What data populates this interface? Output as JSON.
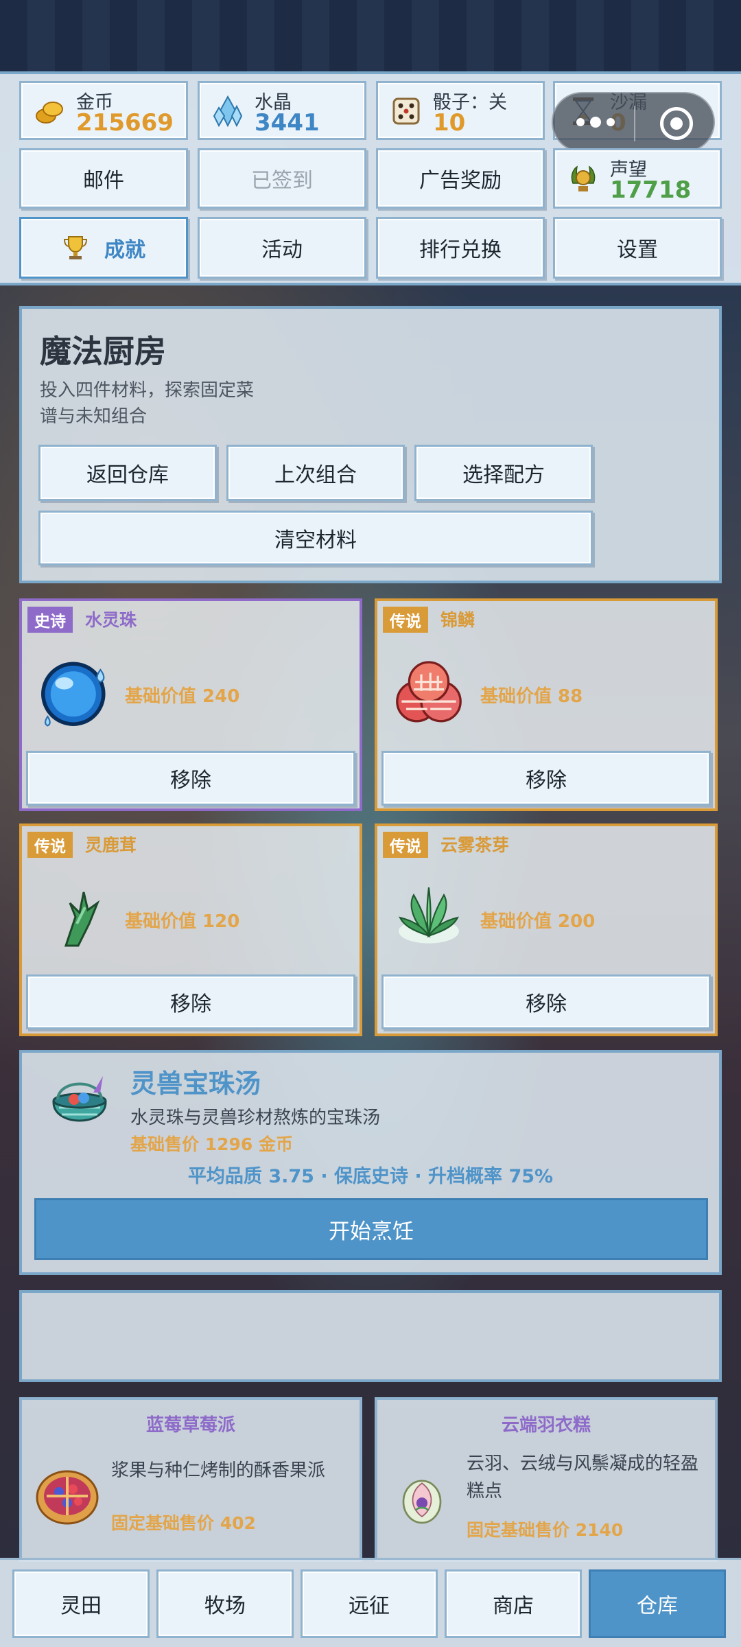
{
  "stats": {
    "gold": {
      "label": "金币",
      "value": "215669"
    },
    "crystal": {
      "label": "水晶",
      "value": "3441"
    },
    "dice": {
      "label": "骰子：关",
      "value": "10"
    },
    "hourglass": {
      "label": "沙漏",
      "value": "0"
    },
    "reputation": {
      "label": "声望",
      "value": "17718"
    }
  },
  "menu": {
    "mail": "邮件",
    "signed": "已签到",
    "ad_reward": "广告奖励",
    "achievement": "成就",
    "activity": "活动",
    "rank_exchange": "排行兑换",
    "settings": "设置"
  },
  "kitchen": {
    "title": "魔法厨房",
    "desc_line1": "投入四件材料，探索固定菜",
    "desc_line2": "谱与未知组合",
    "btn_back": "返回仓库",
    "btn_last": "上次组合",
    "btn_recipe": "选择配方",
    "btn_clear": "清空材料"
  },
  "ingredients": [
    {
      "rarity": "史诗",
      "name": "水灵珠",
      "value_text": "基础价值 240",
      "remove": "移除",
      "icon": "water-orb-icon"
    },
    {
      "rarity": "传说",
      "name": "锦鳞",
      "value_text": "基础价值 88",
      "remove": "移除",
      "icon": "brocade-scale-icon"
    },
    {
      "rarity": "传说",
      "name": "灵鹿茸",
      "value_text": "基础价值 120",
      "remove": "移除",
      "icon": "antler-icon"
    },
    {
      "rarity": "传说",
      "name": "云雾茶芽",
      "value_text": "基础价值 200",
      "remove": "移除",
      "icon": "tea-sprout-icon"
    }
  ],
  "result": {
    "name": "灵兽宝珠汤",
    "desc": "水灵珠与灵兽珍材熬炼的宝珠汤",
    "price": "基础售价 1296 金币",
    "quality": "平均品质 3.75 · 保底史诗 · 升档概率 75%",
    "start": "开始烹饪"
  },
  "recipes": [
    {
      "name": "蓝莓草莓派",
      "desc1": "浆果与种仁烤制的酥香果派",
      "desc2": "",
      "price": "固定基础售价 402"
    },
    {
      "name": "云端羽衣糕",
      "desc1": "云羽、云绒与风鬃凝成的轻盈",
      "desc2": "糕点",
      "price": "固定基础售价 2140"
    }
  ],
  "tabs": [
    "灵田",
    "牧场",
    "远征",
    "商店",
    "仓库"
  ],
  "colors": {
    "gold": "#e09a2c",
    "crystal": "#3f86c4",
    "reputation": "#4f9e48",
    "epic": "#8e6bc9",
    "legendary": "#d99a38",
    "active_tab": "#4f94c9"
  }
}
